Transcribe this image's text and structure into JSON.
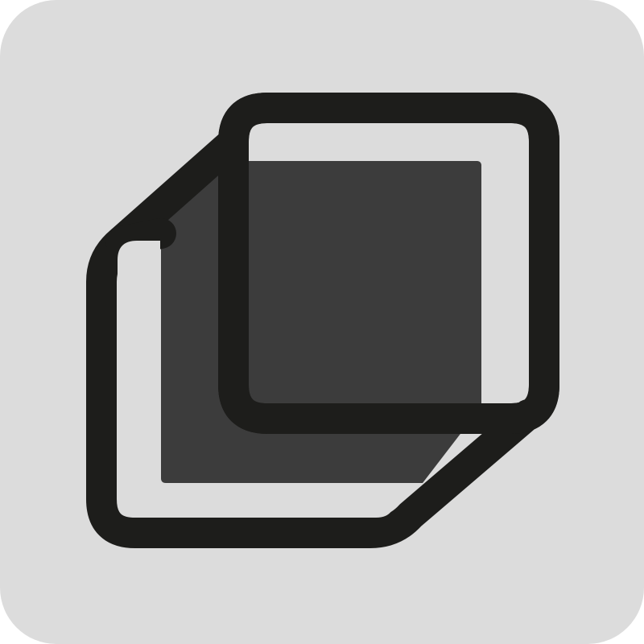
{
  "icon": {
    "name": "box-3d-icon",
    "colors": {
      "tile_background": "#dcdcdc",
      "outline": "#1d1d1b",
      "fill": "#3c3c3c",
      "inner_window": "#dcdcdc"
    }
  }
}
